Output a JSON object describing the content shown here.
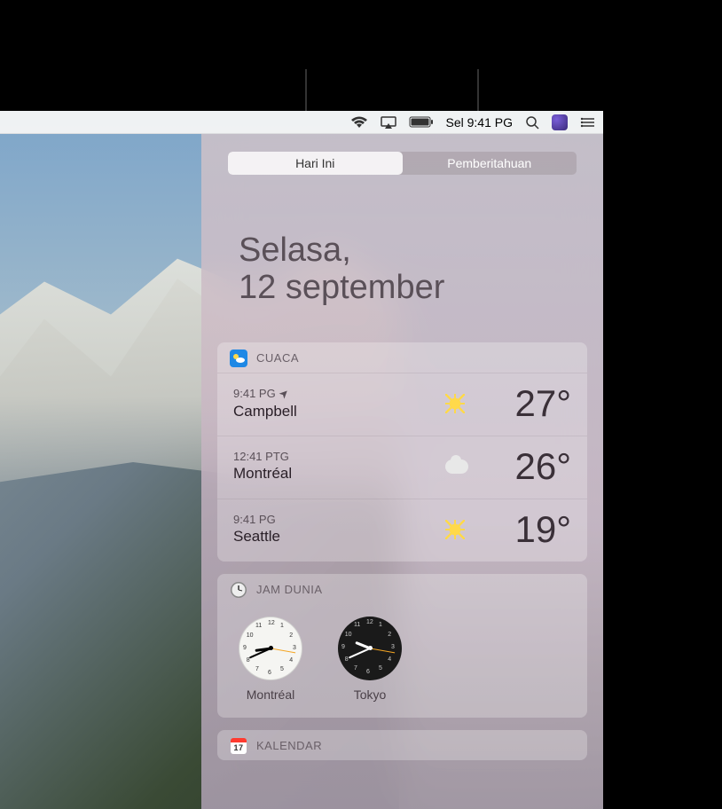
{
  "menubar": {
    "time": "Sel 9:41 PG"
  },
  "tabs": {
    "today": "Hari Ini",
    "notifications": "Pemberitahuan"
  },
  "date": {
    "day": "Selasa,",
    "date": "12 september"
  },
  "weather": {
    "title": "CUACA",
    "locations": [
      {
        "time": "9:41 PG",
        "local": true,
        "city": "Campbell",
        "condition": "sunny",
        "temp": "27°"
      },
      {
        "time": "12:41 PTG",
        "local": false,
        "city": "Montréal",
        "condition": "cloudy",
        "temp": "26°"
      },
      {
        "time": "9:41 PG",
        "local": false,
        "city": "Seattle",
        "condition": "sunny",
        "temp": "19°"
      }
    ]
  },
  "worldclock": {
    "title": "JAM DUNIA",
    "clocks": [
      {
        "city": "Montréal",
        "face": "white",
        "hour_angle": 262,
        "min_angle": 246,
        "sec_angle": 100
      },
      {
        "city": "Tokyo",
        "face": "black",
        "hour_angle": 292,
        "min_angle": 246,
        "sec_angle": 100
      }
    ]
  },
  "calendar": {
    "title": "KALENDAR",
    "icon_day": "17"
  }
}
